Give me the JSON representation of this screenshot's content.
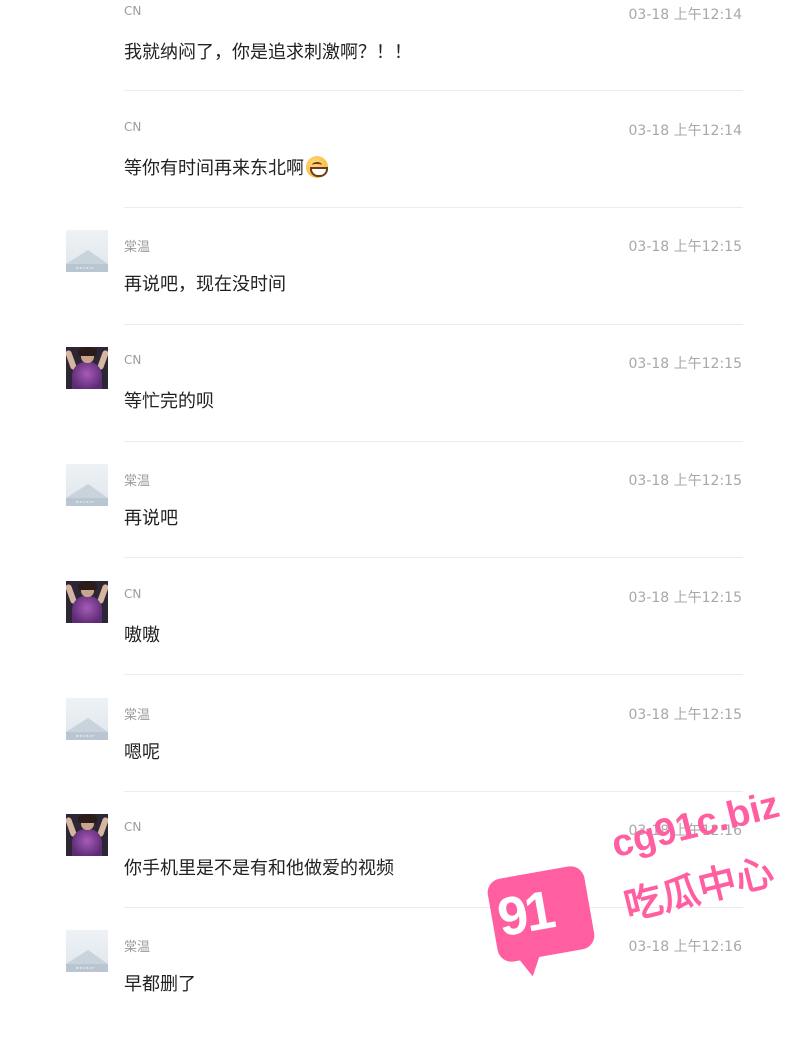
{
  "messages": [
    {
      "name": "CN",
      "time": "03-18 上午12:14",
      "text": "我就纳闷了，你是追求刺激啊？！！",
      "avatar": "none",
      "emoji": ""
    },
    {
      "name": "CN",
      "time": "03-18 上午12:14",
      "text": "等你有时间再来东北啊",
      "avatar": "none",
      "emoji": "grinning-face-emoji"
    },
    {
      "name": "棠温",
      "time": "03-18 上午12:15",
      "text": "再说吧，现在没时间",
      "avatar": "placeholder",
      "emoji": ""
    },
    {
      "name": "CN",
      "time": "03-18 上午12:15",
      "text": "等忙完的呗",
      "avatar": "photo",
      "emoji": ""
    },
    {
      "name": "棠温",
      "time": "03-18 上午12:15",
      "text": "再说吧",
      "avatar": "placeholder",
      "emoji": ""
    },
    {
      "name": "CN",
      "time": "03-18 上午12:15",
      "text": "嗷嗷",
      "avatar": "photo",
      "emoji": ""
    },
    {
      "name": "棠温",
      "time": "03-18 上午12:15",
      "text": "嗯呢",
      "avatar": "placeholder",
      "emoji": ""
    },
    {
      "name": "CN",
      "time": "03-18 上午12:16",
      "text": "你手机里是不是有和他做爱的视频",
      "avatar": "photo",
      "emoji": ""
    },
    {
      "name": "棠温",
      "time": "03-18 上午12:16",
      "text": "早都删了",
      "avatar": "placeholder",
      "emoji": ""
    }
  ],
  "avatar_placeholder_caption": "WECHAT",
  "watermark": {
    "number": "91",
    "domain": "cg91c.biz",
    "title": "吃瓜中心",
    "color": "#ff5fa1"
  },
  "colors": {
    "name": "#9c9c9c",
    "time": "#a8a8a8",
    "text": "#222222",
    "divider": "#ececec"
  }
}
